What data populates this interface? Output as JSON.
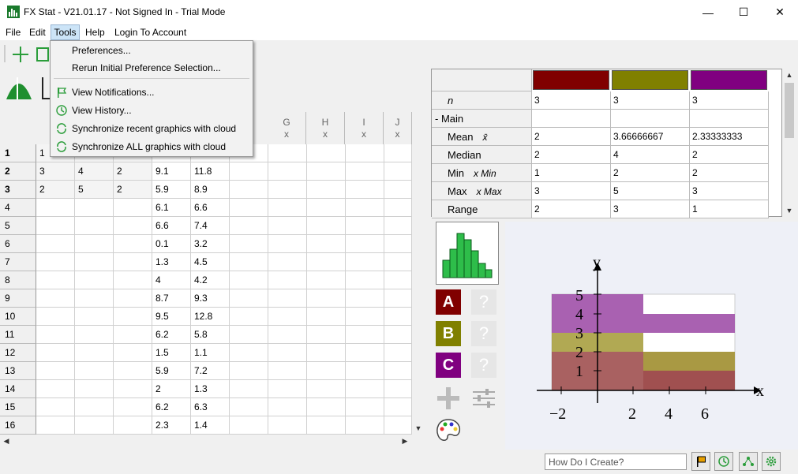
{
  "window": {
    "title": "FX Stat - V21.01.17 - Not Signed In - Trial Mode",
    "minimize": "—",
    "maximize": "☐",
    "close": "✕"
  },
  "menubar": {
    "file": "File",
    "edit": "Edit",
    "tools": "Tools",
    "help": "Help",
    "login": "Login To Account"
  },
  "tools_menu": {
    "items": [
      "Preferences...",
      "Rerun Initial Preference Selection...",
      "View Notifications...",
      "View History...",
      "Synchronize recent graphics with cloud",
      "Synchronize ALL graphics with cloud"
    ]
  },
  "sheet": {
    "columns": [
      {
        "l": "G",
        "s": "x"
      },
      {
        "l": "H",
        "s": "x"
      },
      {
        "l": "I",
        "s": "x"
      },
      {
        "l": "J",
        "s": "x"
      }
    ],
    "rows": [
      {
        "n": "1",
        "c": [
          "1",
          "",
          "",
          "",
          ""
        ]
      },
      {
        "n": "2",
        "c": [
          "3",
          "4",
          "2",
          "9.1",
          "11.8"
        ]
      },
      {
        "n": "3",
        "c": [
          "2",
          "5",
          "2",
          "5.9",
          "8.9"
        ]
      },
      {
        "n": "4",
        "c": [
          "",
          "",
          "",
          "6.1",
          "6.6"
        ]
      },
      {
        "n": "5",
        "c": [
          "",
          "",
          "",
          "6.6",
          "7.4"
        ]
      },
      {
        "n": "6",
        "c": [
          "",
          "",
          "",
          "0.1",
          "3.2"
        ]
      },
      {
        "n": "7",
        "c": [
          "",
          "",
          "",
          "1.3",
          "4.5"
        ]
      },
      {
        "n": "8",
        "c": [
          "",
          "",
          "",
          "4",
          "4.2"
        ]
      },
      {
        "n": "9",
        "c": [
          "",
          "",
          "",
          "8.7",
          "9.3"
        ]
      },
      {
        "n": "10",
        "c": [
          "",
          "",
          "",
          "9.5",
          "12.8"
        ]
      },
      {
        "n": "11",
        "c": [
          "",
          "",
          "",
          "6.2",
          "5.8"
        ]
      },
      {
        "n": "12",
        "c": [
          "",
          "",
          "",
          "1.5",
          "1.1"
        ]
      },
      {
        "n": "13",
        "c": [
          "",
          "",
          "",
          "5.9",
          "7.2"
        ]
      },
      {
        "n": "14",
        "c": [
          "",
          "",
          "",
          "2",
          "1.3"
        ]
      },
      {
        "n": "15",
        "c": [
          "",
          "",
          "",
          "6.2",
          "6.3"
        ]
      },
      {
        "n": "16",
        "c": [
          "",
          "",
          "",
          "2.3",
          "1.4"
        ]
      }
    ]
  },
  "stats": {
    "colors": [
      "#800000",
      "#808000",
      "#800080"
    ],
    "rows": [
      {
        "label": "n",
        "sym": "",
        "vals": [
          "3",
          "3",
          "3"
        ]
      },
      {
        "label": "- Main",
        "sym": "",
        "vals": [
          "",
          "",
          ""
        ]
      },
      {
        "label": "Mean",
        "sym": "x̄",
        "vals": [
          "2",
          "3.66666667",
          "2.33333333"
        ]
      },
      {
        "label": "Median",
        "sym": "",
        "vals": [
          "2",
          "4",
          "2"
        ]
      },
      {
        "label": "Min",
        "sym": "x Min",
        "vals": [
          "1",
          "2",
          "2"
        ]
      },
      {
        "label": "Max",
        "sym": "x Max",
        "vals": [
          "3",
          "5",
          "3"
        ]
      },
      {
        "label": "Range",
        "sym": "",
        "vals": [
          "2",
          "3",
          "1"
        ]
      }
    ]
  },
  "datasets": [
    {
      "label": "A",
      "color": "#800000"
    },
    {
      "label": "B",
      "color": "#808000"
    },
    {
      "label": "C",
      "color": "#800080"
    }
  ],
  "plot": {
    "xlabel": "x",
    "ylabel": "y",
    "xticks": [
      "−2",
      "2",
      "4",
      "6"
    ],
    "yticks": [
      "1",
      "2",
      "3",
      "4",
      "5"
    ]
  },
  "status": {
    "help_placeholder": "How Do I Create?"
  }
}
